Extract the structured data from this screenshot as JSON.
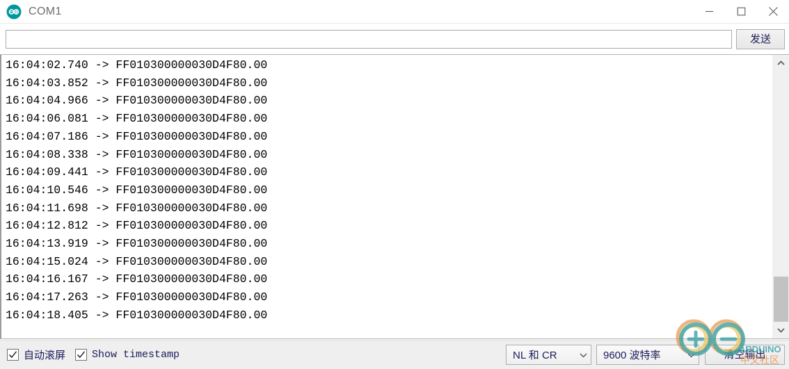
{
  "window": {
    "title": "COM1",
    "app_icon": "arduino-logo-icon",
    "controls": {
      "minimize": "minimize-icon",
      "maximize": "maximize-icon",
      "close": "close-icon"
    }
  },
  "send_bar": {
    "input_value": "",
    "input_placeholder": "",
    "send_label": "发送"
  },
  "console": {
    "lines": [
      "16:04:02.740 -> FF010300000030D4F80.00",
      "16:04:03.852 -> FF010300000030D4F80.00",
      "16:04:04.966 -> FF010300000030D4F80.00",
      "16:04:06.081 -> FF010300000030D4F80.00",
      "16:04:07.186 -> FF010300000030D4F80.00",
      "16:04:08.338 -> FF010300000030D4F80.00",
      "16:04:09.441 -> FF010300000030D4F80.00",
      "16:04:10.546 -> FF010300000030D4F80.00",
      "16:04:11.698 -> FF010300000030D4F80.00",
      "16:04:12.812 -> FF010300000030D4F80.00",
      "16:04:13.919 -> FF010300000030D4F80.00",
      "16:04:15.024 -> FF010300000030D4F80.00",
      "16:04:16.167 -> FF010300000030D4F80.00",
      "16:04:17.263 -> FF010300000030D4F80.00",
      "16:04:18.405 -> FF010300000030D4F80.00"
    ]
  },
  "scrollbar": {
    "up_icon": "chevron-up-icon",
    "down_icon": "chevron-down-icon",
    "thumb_top_pct": 82,
    "thumb_height_pct": 19
  },
  "statusbar": {
    "autoscroll": {
      "label": "自动滚屏",
      "checked": true
    },
    "timestamp": {
      "label": "Show timestamp",
      "checked": true
    },
    "line_ending": {
      "value": "NL 和 CR",
      "arrow_icon": "chevron-down-icon"
    },
    "baud_rate": {
      "value": "9600 波特率",
      "arrow_icon": "chevron-down-icon"
    },
    "clear_output_label": "清空输出"
  },
  "watermark": {
    "brand": "ARDUINO",
    "subtitle": "中文社区",
    "colors": {
      "teal": "#2b9b9e",
      "orange": "#e98a3c",
      "yellow": "#e8c04a"
    }
  },
  "colors": {
    "accent_teal": "#00979c",
    "title_text": "#6e6e6e",
    "control_text": "#1b1b5a",
    "statusbar_bg": "#efefef",
    "console_bg": "#ffffff",
    "console_text": "#000000"
  }
}
